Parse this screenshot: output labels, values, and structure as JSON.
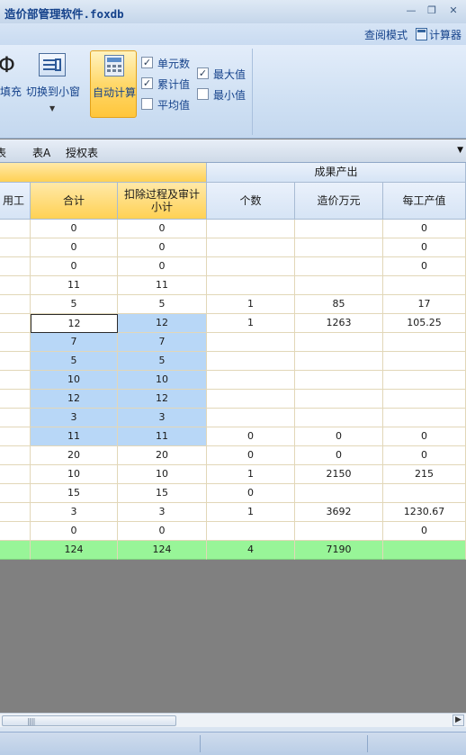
{
  "window": {
    "title": "造价部管理软件.foxdb"
  },
  "quickbar": {
    "view_mode": "查阅模式",
    "calculator": "计算器"
  },
  "ribbon": {
    "fill_label": "填充",
    "switch_label": "切换到小窗",
    "autocalc_label": "自动计算",
    "checks": [
      {
        "label": "单元数",
        "checked": true
      },
      {
        "label": "累计值",
        "checked": true
      },
      {
        "label": "平均值",
        "checked": false
      },
      {
        "label": "最大值",
        "checked": true
      },
      {
        "label": "最小值",
        "checked": false
      }
    ]
  },
  "tabs": [
    "表",
    "表A",
    "授权表"
  ],
  "table": {
    "group_header": "成果产出",
    "headers": [
      "用工",
      "合计",
      "扣除过程及审计\n小计",
      "个数",
      "造价万元",
      "每工产值"
    ],
    "rows": [
      [
        "",
        "0",
        "0",
        "",
        "",
        "0"
      ],
      [
        "",
        "0",
        "0",
        "",
        "",
        "0"
      ],
      [
        "",
        "0",
        "0",
        "",
        "",
        "0"
      ],
      [
        "",
        "11",
        "11",
        "",
        "",
        ""
      ],
      [
        "",
        "5",
        "5",
        "1",
        "85",
        "17"
      ],
      [
        "",
        "12",
        "12",
        "1",
        "1263",
        "105.25"
      ],
      [
        "",
        "7",
        "7",
        "",
        "",
        ""
      ],
      [
        "",
        "5",
        "5",
        "",
        "",
        ""
      ],
      [
        "",
        "10",
        "10",
        "",
        "",
        ""
      ],
      [
        "",
        "12",
        "12",
        "",
        "",
        ""
      ],
      [
        "",
        "3",
        "3",
        "",
        "",
        ""
      ],
      [
        "",
        "11",
        "11",
        "0",
        "0",
        "0"
      ],
      [
        "",
        "20",
        "20",
        "0",
        "0",
        "0"
      ],
      [
        "",
        "10",
        "10",
        "1",
        "2150",
        "215"
      ],
      [
        "",
        "15",
        "15",
        "0",
        "",
        ""
      ],
      [
        "",
        "3",
        "3",
        "1",
        "3692",
        "1230.67"
      ],
      [
        "",
        "0",
        "0",
        "",
        "",
        "0"
      ]
    ],
    "total_row": [
      "",
      "124",
      "124",
      "4",
      "7190",
      ""
    ],
    "selected_rows": [
      5,
      6,
      7,
      8,
      9,
      10,
      11
    ],
    "active_row": 5
  },
  "colors": {
    "header_gold": "#ffd154",
    "selection": "#b8d7f7",
    "total_row": "#98f598"
  }
}
